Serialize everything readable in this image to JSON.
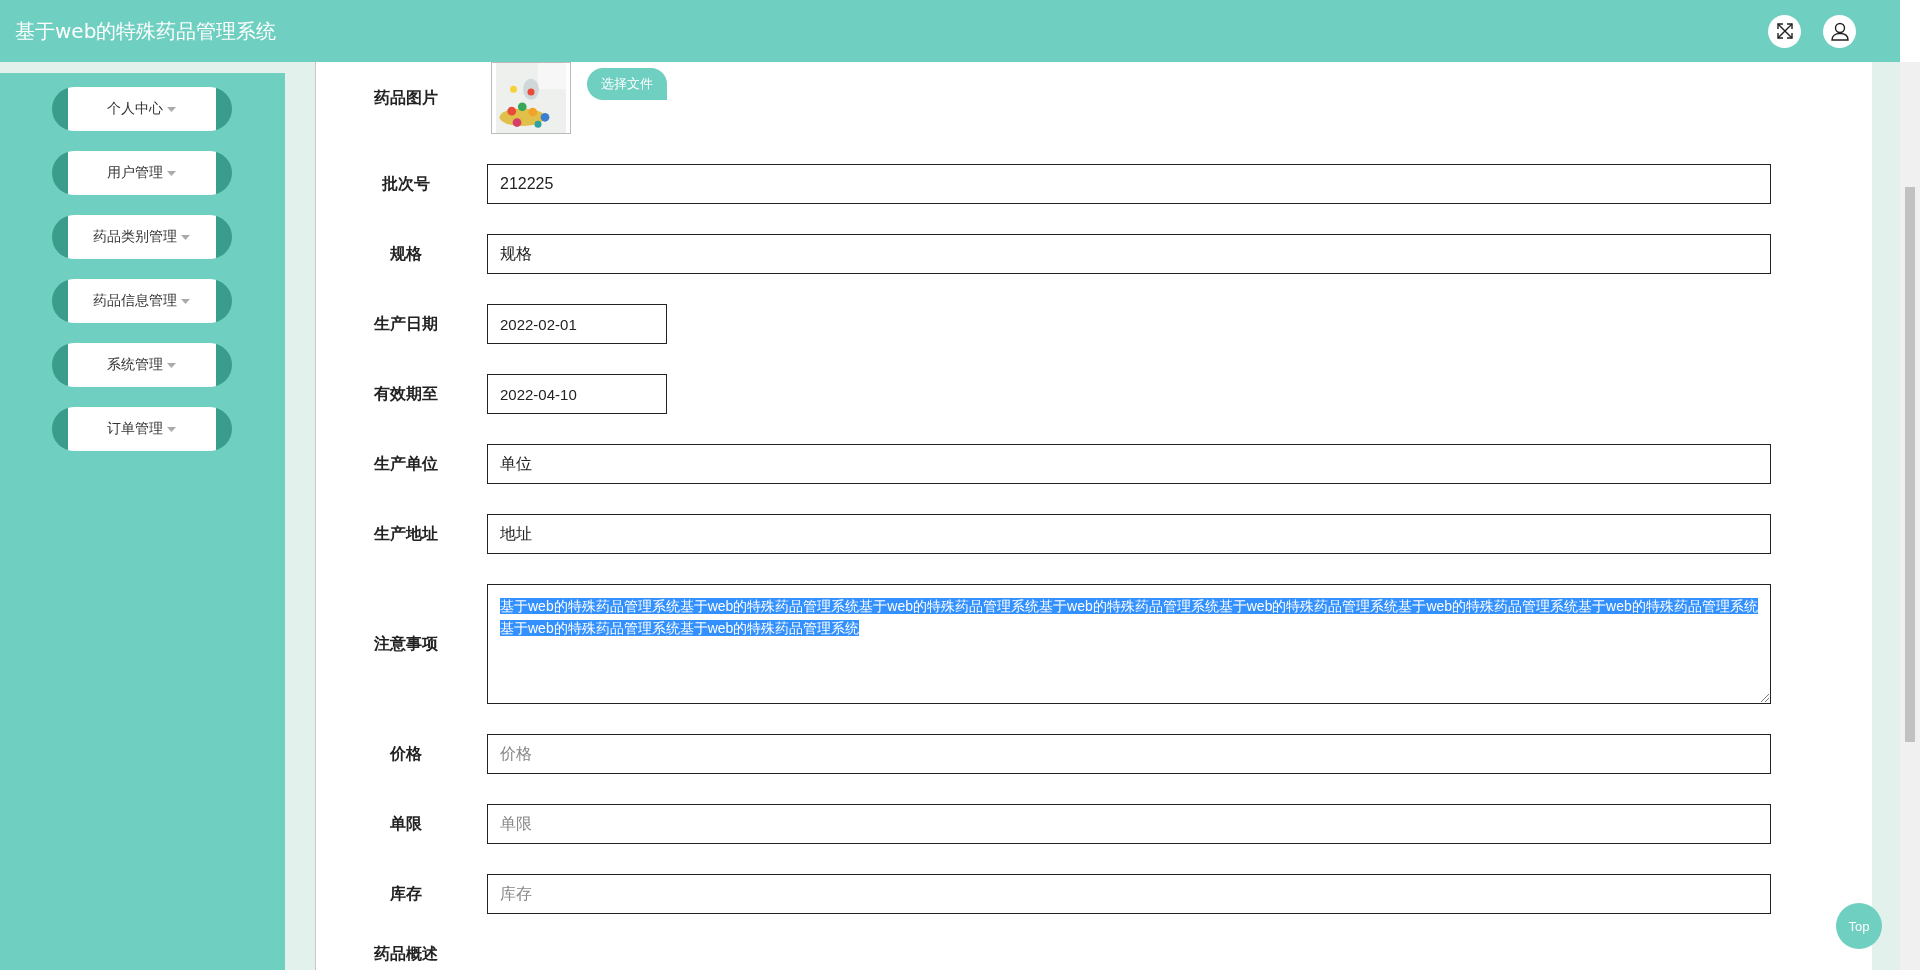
{
  "header": {
    "title": "基于web的特殊药品管理系统"
  },
  "sidebar": {
    "items": [
      {
        "label": "个人中心"
      },
      {
        "label": "用户管理"
      },
      {
        "label": "药品类别管理"
      },
      {
        "label": "药品信息管理"
      },
      {
        "label": "系统管理"
      },
      {
        "label": "订单管理"
      }
    ]
  },
  "form": {
    "fields": [
      {
        "label": "药品图片",
        "button": "选择文件"
      },
      {
        "kind": "text",
        "label": "批次号",
        "value": "212225"
      },
      {
        "kind": "text",
        "label": "规格",
        "value": "规格"
      },
      {
        "kind": "date",
        "label": "生产日期",
        "value": "2022-02-01"
      },
      {
        "kind": "date",
        "label": "有效期至",
        "value": "2022-04-10"
      },
      {
        "kind": "text",
        "label": "生产单位",
        "value": "单位"
      },
      {
        "kind": "text",
        "label": "生产地址",
        "value": "地址"
      },
      {
        "kind": "textarea",
        "label": "注意事项",
        "value": "基于web的特殊药品管理系统基于web的特殊药品管理系统基于web的特殊药品管理系统基于web的特殊药品管理系统基于web的特殊药品管理系统基于web的特殊药品管理系统基于web的特殊药品管理系统基于web的特殊药品管理系统基于web的特殊药品管理系统",
        "text_selected": true
      },
      {
        "kind": "text",
        "label": "价格",
        "placeholder": "价格"
      },
      {
        "kind": "text",
        "label": "单限",
        "placeholder": "单限"
      },
      {
        "kind": "text",
        "label": "库存",
        "placeholder": "库存"
      },
      {
        "kind": "label",
        "label": "药品概述"
      }
    ]
  },
  "back_to_top": "Top"
}
